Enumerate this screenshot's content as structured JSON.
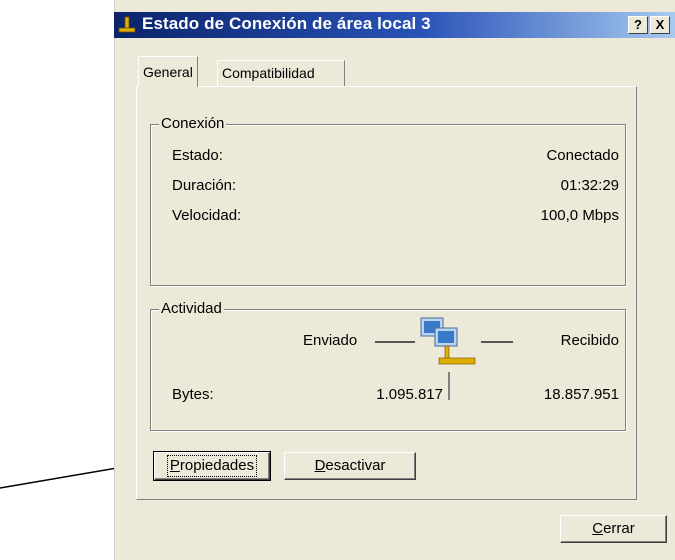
{
  "window": {
    "title": "Estado de Conexión de área local 3",
    "help_glyph": "?",
    "close_glyph": "X"
  },
  "tabs": [
    {
      "label": "General",
      "selected": true
    },
    {
      "label": "Compatibilidad",
      "selected": false
    }
  ],
  "conexion": {
    "group_label": "Conexión",
    "rows": [
      {
        "label": "Estado:",
        "value": "Conectado"
      },
      {
        "label": "Duración:",
        "value": "01:32:29"
      },
      {
        "label": "Velocidad:",
        "value": "100,0 Mbps"
      }
    ]
  },
  "actividad": {
    "group_label": "Actividad",
    "sent_label": "Enviado",
    "received_label": "Recibido",
    "bytes_label": "Bytes:",
    "bytes_sent": "1.095.817",
    "bytes_received": "18.857.951",
    "icon": "network-activity-icon"
  },
  "buttons": {
    "properties": {
      "prefix": "",
      "mnemonic": "P",
      "rest": "ropiedades"
    },
    "disable": {
      "mnemonic": "D",
      "rest": "esactivar"
    },
    "close": {
      "mnemonic": "C",
      "rest": "errar"
    }
  },
  "colors": {
    "dialog_bg": "#ece9d8",
    "titlebar_start": "#0a246a",
    "titlebar_end": "#a6caf0",
    "arrow": "#000000"
  }
}
